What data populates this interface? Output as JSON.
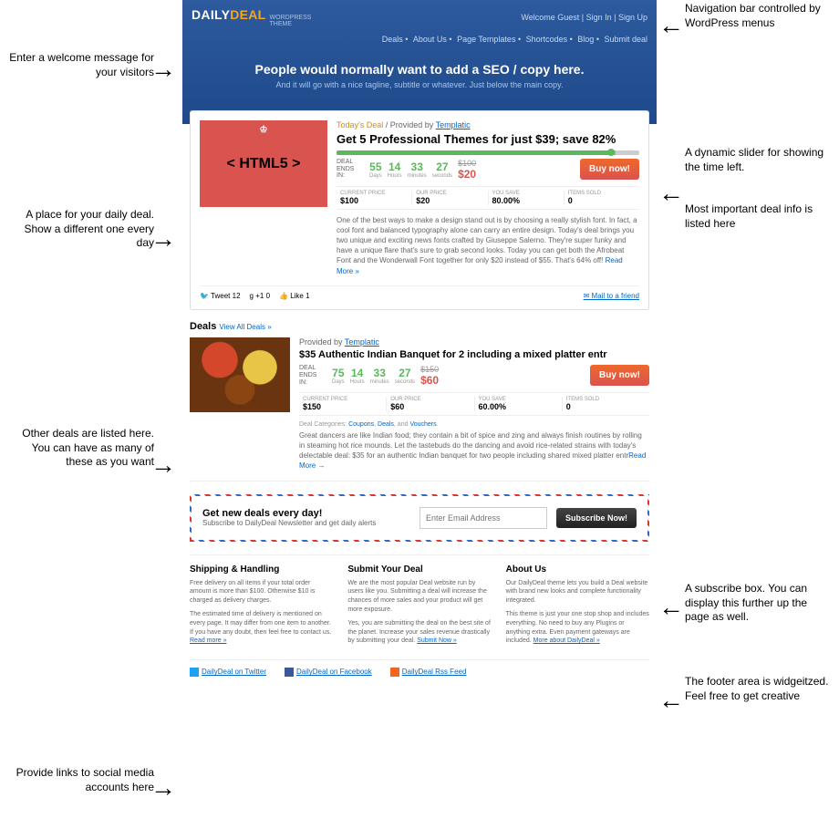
{
  "logo": {
    "main": "DAILY",
    "deal": "DEAL",
    "sub1": "WORDPRESS",
    "sub2": "THEME"
  },
  "topbar": {
    "welcome": "Welcome Guest",
    "signin": "Sign In",
    "signup": "Sign Up"
  },
  "nav": [
    "Deals",
    "About Us",
    "Page Templates",
    "Shortcodes",
    "Blog",
    "Submit deal"
  ],
  "hero": {
    "title": "People would normally want to add a SEO / copy here.",
    "sub": "And it will go with a nice tagline, subtitle or whatever. Just below the main copy."
  },
  "deal1": {
    "img_text": "< HTML5 >",
    "today": "Today's Deal",
    "by": "Provided by",
    "provider": "Templatic",
    "title": "Get 5 Professional Themes for just $39; save 82%",
    "ends_label": "DEAL ENDS IN:",
    "countdown": [
      {
        "v": "55",
        "l": "Days"
      },
      {
        "v": "14",
        "l": "Hours"
      },
      {
        "v": "33",
        "l": "minutes"
      },
      {
        "v": "27",
        "l": "seconds"
      }
    ],
    "old_price": "$100",
    "new_price": "$20",
    "buy": "Buy now!",
    "stats": [
      {
        "l": "CURRENT PRICE",
        "v": "$100"
      },
      {
        "l": "OUR PRICE",
        "v": "$20"
      },
      {
        "l": "YOU SAVE",
        "v": "80.00%"
      },
      {
        "l": "ITEMS SOLD",
        "v": "0"
      }
    ],
    "desc": "One of the best ways to make a design stand out is by choosing a really stylish font. In fact, a cool font and balanced typography alone can carry an entire design. Today's deal brings you two unique and exciting news fonts crafted by Giuseppe Salerno. They're super funky and have a unique flare that's sure to grab second looks. Today you can get both the Afrobeat Font and the Wonderwall Font together for only $20 instead of $55. That's 64% off!",
    "read_more": "Read More »"
  },
  "share": {
    "tweet": "Tweet",
    "tweet_n": "12",
    "g": "+1",
    "g_n": "0",
    "like": "Like",
    "like_n": "1",
    "mail": "Mail to a friend"
  },
  "deals_h": "Deals",
  "view_all": "View All Deals »",
  "deal2": {
    "by": "Provided by",
    "provider": "Templatic",
    "title": "$35 Authentic Indian Banquet for 2 including a mixed platter entr",
    "ends_label": "DEAL ENDS IN:",
    "countdown": [
      {
        "v": "75",
        "l": "Days"
      },
      {
        "v": "14",
        "l": "Hours"
      },
      {
        "v": "33",
        "l": "minutes"
      },
      {
        "v": "27",
        "l": "seconds"
      }
    ],
    "old_price": "$150",
    "new_price": "$60",
    "buy": "Buy now!",
    "stats": [
      {
        "l": "CURRENT PRICE",
        "v": "$150"
      },
      {
        "l": "OUR PRICE",
        "v": "$60"
      },
      {
        "l": "YOU SAVE",
        "v": "60.00%"
      },
      {
        "l": "ITEMS SOLD",
        "v": "0"
      }
    ],
    "cat_label": "Deal Categories:",
    "cats": [
      "Coupons",
      "Deals",
      "Vouchers"
    ],
    "cat_and": ", and ",
    "desc": "Great dancers are like Indian food; they contain a bit of spice and zing and always finish routines by rolling in steaming hot rice mounds. Let the tastebuds do the dancing and avoid rice-related strains with today's delectable deal: $35 for an authentic Indian banquet for two people including shared mixed platter entr",
    "read_more": "Read More →"
  },
  "subscribe": {
    "h": "Get new deals every day!",
    "s": "Subscribe to DailyDeal Newsletter and get daily alerts",
    "placeholder": "Enter Email Address",
    "btn": "Subscribe Now!"
  },
  "footer": [
    {
      "h": "Shipping & Handling",
      "p1": "Free delivery on all items if your total order amount is more than $100. Otherwise $10 is charged as delivery charges.",
      "p2": "The estimated time of delivery is mentioned on every page. It may differ from one item to another. If you have any doubt, then feel free to contact us.",
      "link": "Read more »"
    },
    {
      "h": "Submit Your Deal",
      "p1": "We are the most popular Deal website run by users like you. Submitting a deal will increase the chances of more sales and your product will get more exposure.",
      "p2": "Yes, you are submitting the deal on the best site of the planet. Increase your sales revenue drastically by submitting your deal.",
      "link": "Submit Now »"
    },
    {
      "h": "About Us",
      "p1": "Our DailyDeal theme lets you build a Deal website with brand new looks and complete functionality integrated.",
      "p2": "This theme is just your one stop shop and includes everything. No need to buy any Plugins or anything extra. Even payment gateways are included.",
      "link": "More about DailyDeal »"
    }
  ],
  "social": [
    {
      "c": "si-t",
      "t": "DailyDeal on Twitter"
    },
    {
      "c": "si-f",
      "t": "DailyDeal on Facebook"
    },
    {
      "c": "si-r",
      "t": "DailyDeal Rss Feed"
    }
  ],
  "annotations": {
    "a1": "Enter a welcome message for your visitors",
    "a2": "A place for your daily deal. Show a different one every day",
    "a3": "Other deals are listed here. You can have as many of these as you want",
    "a4": "Provide links to social media accounts here",
    "a5": "Navigation bar controlled by WordPress menus",
    "a6": "A dynamic slider for showing the time left.",
    "a7": "Most important deal info is listed here",
    "a8": "A subscribe box. You can display this further up the page as well.",
    "a9": "The footer area is widgeitzed. Feel free to get creative"
  }
}
